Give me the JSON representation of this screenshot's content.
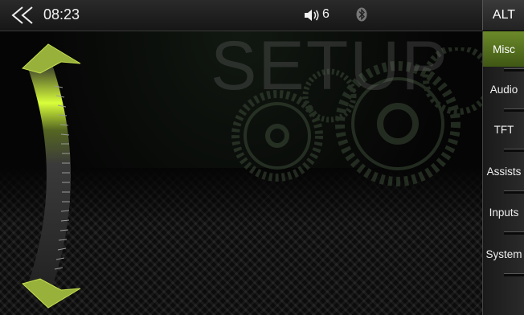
{
  "status_bar": {
    "back_icon": "double-chevron-left-icon",
    "time": "08:23",
    "volume_icon": "speaker-icon",
    "volume_level": "6",
    "bluetooth_icon": "bluetooth-icon"
  },
  "alt_button": {
    "label": "ALT"
  },
  "page": {
    "title": "SETUP"
  },
  "sidebar": {
    "tabs": [
      {
        "label": "Misc",
        "active": true
      },
      {
        "label": "Audio",
        "active": false
      },
      {
        "label": "TFT",
        "active": false
      },
      {
        "label": "Assists",
        "active": false
      },
      {
        "label": "Inputs",
        "active": false
      },
      {
        "label": "System",
        "active": false
      }
    ]
  },
  "colors": {
    "accent": "#7f9f2a",
    "highlight": "#d9ff3a"
  }
}
